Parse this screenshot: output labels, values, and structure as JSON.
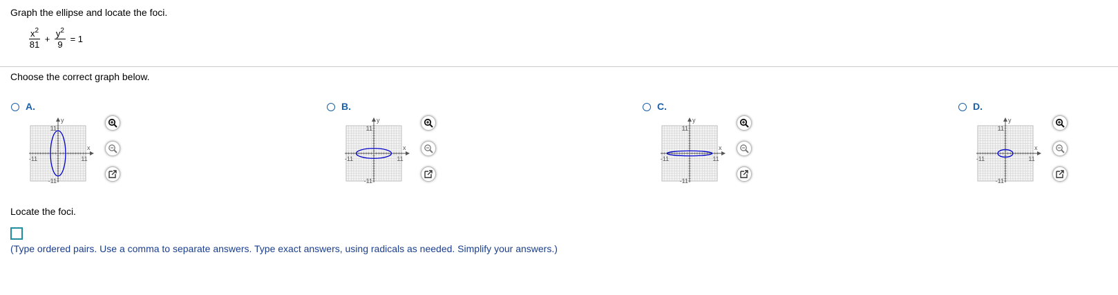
{
  "question": {
    "prompt": "Graph the ellipse and locate the foci.",
    "equation": {
      "term1_num": "x",
      "term1_den": "81",
      "term2_num": "y",
      "term2_den": "9",
      "exponent": "2",
      "plus": "+",
      "equals": "= 1"
    },
    "choose_text": "Choose the correct graph below."
  },
  "options": [
    {
      "label": "A.",
      "rx_units": 3,
      "ry_units": 9
    },
    {
      "label": "B.",
      "rx_units": 7,
      "ry_units": 2
    },
    {
      "label": "C.",
      "rx_units": 9,
      "ry_units": 1
    },
    {
      "label": "D.",
      "rx_units": 3,
      "ry_units": 1.5
    }
  ],
  "graph_labels": {
    "y_axis": "y",
    "x_axis": "x",
    "y_max": "11",
    "y_min": "-11",
    "x_max": "11",
    "x_min": "-11"
  },
  "tool_icons": [
    "zoom-in-icon",
    "zoom-out-icon",
    "open-external-icon"
  ],
  "foci": {
    "label": "Locate the foci.",
    "answer_value": "",
    "hint": "(Type ordered pairs. Use a comma to separate answers.  Type exact answers, using radicals as needed. Simplify your answers.)"
  },
  "colors": {
    "accent": "#1a5fa8",
    "ellipse": "#0000cc",
    "grid": "#d0d0d0",
    "hint_text": "#1a3e8c",
    "answer_border": "#1f8fa0"
  }
}
